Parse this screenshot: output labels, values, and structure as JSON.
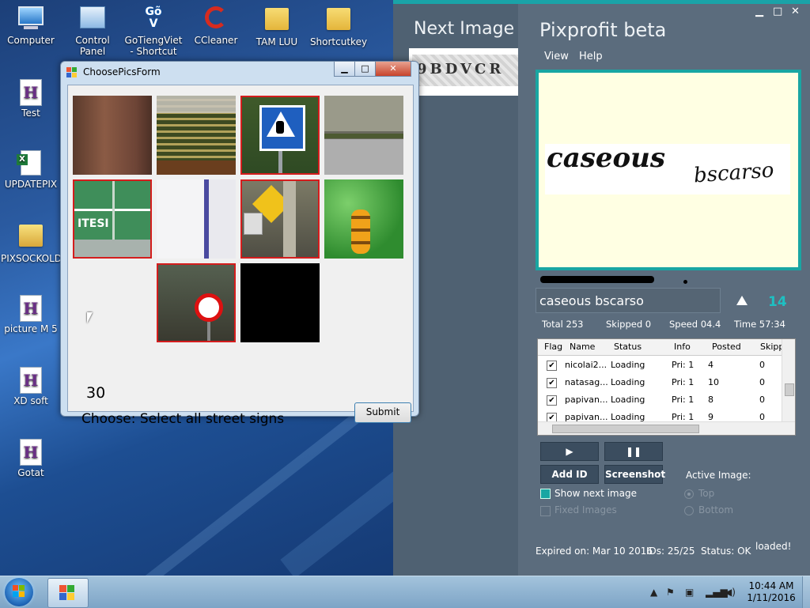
{
  "desktop": {
    "icons": [
      {
        "label": "Computer"
      },
      {
        "label": "Control Panel"
      },
      {
        "label": "GoTiengViet - Shortcut"
      },
      {
        "label": "CCleaner"
      },
      {
        "label": "TAM LUU"
      },
      {
        "label": "Shortcutkey"
      },
      {
        "label": "Test"
      },
      {
        "label": "UPDATEPIX"
      },
      {
        "label": "PIXSOCKOLD"
      },
      {
        "label": "picture M 5"
      },
      {
        "label": "XD soft"
      },
      {
        "label": "Gotat"
      }
    ],
    "gotiengviet_glyph": "Gõ V"
  },
  "pixprofit": {
    "next_image_label": "Next Image",
    "next_captcha_text": "9BDVCR",
    "app_title": "Pixprofit beta",
    "window_buttons": {
      "minimize": "▁",
      "maximize": "□",
      "close": "✕"
    },
    "menu": {
      "view": "View",
      "help": "Help"
    },
    "captcha": {
      "word1": "caseous",
      "word2": "bscarso"
    },
    "answer_value": "caseous bscarso",
    "count": "14",
    "stats": {
      "total": "Total 253",
      "skipped": "Skipped 0",
      "speed": "Speed 04.4",
      "time": "Time 57:34"
    },
    "grid": {
      "headers": [
        "Flag",
        "Name",
        "Status",
        "Info",
        "Posted",
        "Skipp"
      ],
      "rows": [
        {
          "flag": "✔",
          "name": "nicolai2...",
          "status": "Loading",
          "info": "Pri: 1",
          "posted": "4",
          "skipped": "0"
        },
        {
          "flag": "✔",
          "name": "natasag...",
          "status": "Loading",
          "info": "Pri: 1",
          "posted": "10",
          "skipped": "0"
        },
        {
          "flag": "✔",
          "name": "papivan...",
          "status": "Loading",
          "info": "Pri: 1",
          "posted": "8",
          "skipped": "0"
        },
        {
          "flag": "✔",
          "name": "papivan...",
          "status": "Loading",
          "info": "Pri: 1",
          "posted": "9",
          "skipped": "0"
        }
      ]
    },
    "buttons": {
      "play": "▶",
      "pause": "❚❚",
      "add_id": "Add ID",
      "screenshot": "Screenshot"
    },
    "options": {
      "show_next_image": "Show next image",
      "fixed_images": "Fixed Images",
      "active_image": "Active Image:",
      "top": "Top",
      "bottom": "Bottom"
    },
    "footer": {
      "expired": "Expired on: Mar 10 2016",
      "ids": "IDs: 25/25",
      "status": "Status: OK",
      "loaded": "loaded!"
    }
  },
  "dialog": {
    "title": "ChoosePicsForm",
    "window_buttons": {
      "minimize": "▁",
      "maximize": "□",
      "close": "✕"
    },
    "tiles": [
      {
        "desc": "wall",
        "selected": false
      },
      {
        "desc": "vineyard",
        "selected": false
      },
      {
        "desc": "pedestrian-sign",
        "selected": true
      },
      {
        "desc": "road",
        "selected": false
      },
      {
        "desc": "highway-sign",
        "selected": true
      },
      {
        "desc": "pole",
        "selected": false
      },
      {
        "desc": "school-sign",
        "selected": true
      },
      {
        "desc": "sunflowers",
        "selected": false
      },
      {
        "desc": "empty",
        "selected": false
      },
      {
        "desc": "speed-sign",
        "selected": true
      },
      {
        "desc": "black",
        "selected": false
      }
    ],
    "timer": "30",
    "prompt": "Choose: Select all street signs",
    "submit_label": "Submit"
  },
  "taskbar": {
    "time": "10:44 AM",
    "date": "1/11/2016"
  },
  "colors": {
    "accent": "#19a6a3",
    "count_color": "#1ec0c2",
    "selected_border": "#d41d1d"
  }
}
